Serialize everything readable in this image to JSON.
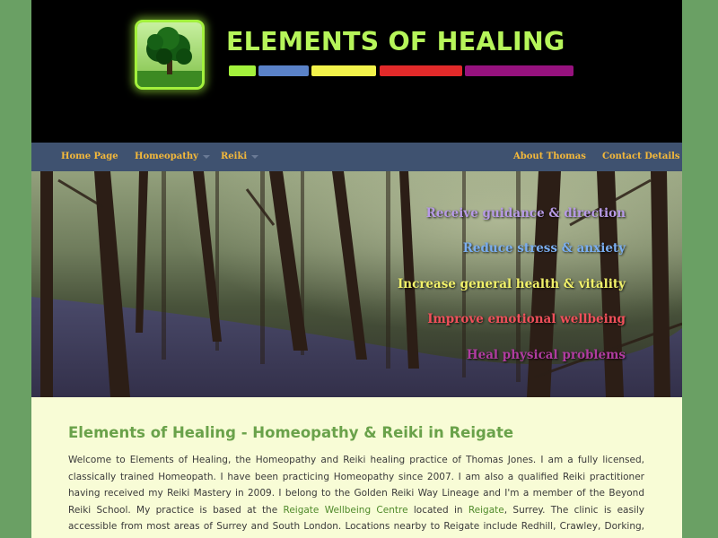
{
  "site": {
    "title": "ELEMENTS OF HEALING",
    "logo_icon": "tree-icon",
    "colors": {
      "background": "#6aa064",
      "title": "#b6f55a",
      "nav_bg": "#3f5270",
      "nav_text": "#f5b93a",
      "content_bg": "#f8fcd6",
      "heading": "#6aa24a"
    },
    "color_bars": [
      "#a3f13c",
      "#5a82c8",
      "#f2f24a",
      "#e22a2a",
      "#96127e"
    ]
  },
  "nav": {
    "home": "Home Page",
    "homeopathy": "Homeopathy",
    "reiki": "Reiki",
    "about": "About Thomas",
    "contact": "Contact Details"
  },
  "hero": {
    "taglines": [
      {
        "text": "Receive guidance & direction",
        "color": "#b79ae6"
      },
      {
        "text": "Reduce stress & anxiety",
        "color": "#7aaef0"
      },
      {
        "text": "Increase general health & vitality",
        "color": "#f2f26a"
      },
      {
        "text": "Improve emotional wellbeing",
        "color": "#f0505a"
      },
      {
        "text": "Heal physical problems",
        "color": "#b03ca0"
      }
    ]
  },
  "main": {
    "heading": "Elements of Healing - Homeopathy & Reiki in Reigate",
    "p1": "Welcome to Elements of Healing, the Homeopathy and Reiki healing practice of Thomas Jones. I am a fully licensed, classically trained Homeopath. I have been practicing Homeopathy since 2007. I am also a qualified Reiki practitioner having received my Reiki Mastery in 2009. I belong to the Golden Reiki Way Lineage and I'm a member of the Beyond Reiki School. My practice is based at the ",
    "link_centre": "Reigate Wellbeing Centre",
    "p2": " located in ",
    "link_reigate": "Reigate",
    "p3": ", Surrey. The clinic is easily accessible from most areas of Surrey and South London. Locations nearby to Reigate include Redhill, Crawley, Dorking, Leatherhead, Guildford, Epsom and Sutton."
  }
}
